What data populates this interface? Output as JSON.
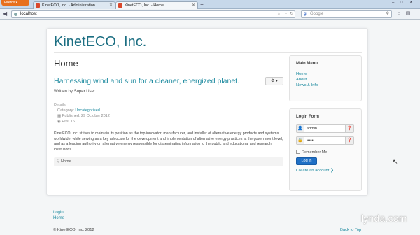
{
  "browser": {
    "app_button": "Firefox",
    "tabs": [
      {
        "label": "KinetECO, Inc. - Administration"
      },
      {
        "label": "KinetECO, Inc. - Home"
      }
    ],
    "url": "localhost",
    "search_placeholder": "Google",
    "search_engine_glyph": "g",
    "new_tab": "+",
    "window_controls": {
      "minimize": "–",
      "maximize": "□",
      "close": "✕"
    }
  },
  "site": {
    "title": "KinetECO, Inc.",
    "page_heading": "Home"
  },
  "article": {
    "title": "Harnessing wind and sun for a cleaner, energized planet.",
    "gear_label": "⚙ ▾",
    "written_by": "Written by Super User",
    "details_label": "Details",
    "category_label": "Category: ",
    "category": "Uncategorised",
    "published": "Published: 29 October 2012",
    "hits": "Hits: 16",
    "body": "KinetECO, Inc. strives to maintain its position as the top innovator, manufacturer, and installer of alternative energy products and systems worldwide, while serving as a key advocate for the development and implementation of alternative energy practices at the government level, and as a leading authority on alternative energy responsible for disseminating information to the public and educational and research institutions.",
    "breadcrumb": "Home"
  },
  "main_menu": {
    "title": "Main Menu",
    "items": [
      "Home",
      "About",
      "News & Info"
    ]
  },
  "login_form": {
    "title": "Login Form",
    "username": "admin",
    "password": "•••••",
    "remember": "Remember Me",
    "login_button": "Log in",
    "create_account": "Create an account ❯"
  },
  "footer": {
    "links": [
      "Login",
      "Home"
    ],
    "copyright": "© KinetECO, Inc. 2012",
    "back_to_top": "Back to Top"
  },
  "watermark": "lynda.com"
}
